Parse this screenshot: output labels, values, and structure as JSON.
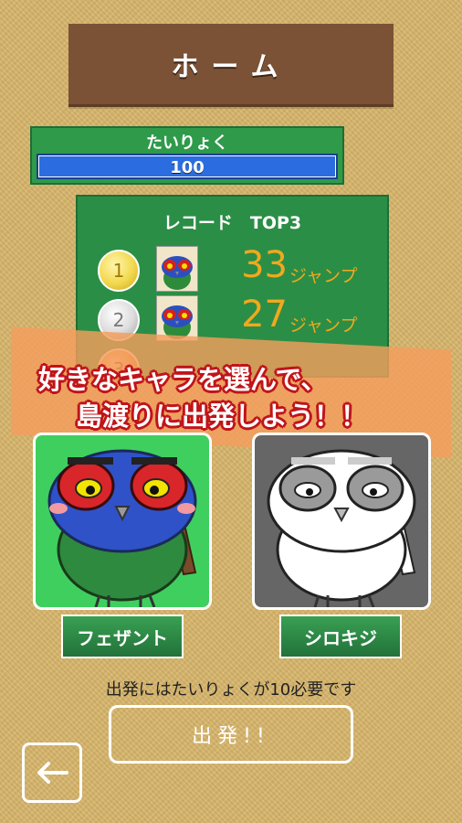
{
  "header": {
    "title": "ホーム"
  },
  "stamina": {
    "label": "たいりょく",
    "value": "100",
    "fraction": 1.0
  },
  "record": {
    "heading": "レコード　TOP3",
    "rows": [
      {
        "rank": "1",
        "score": "33",
        "unit": "ジャンプ",
        "medal": "gold"
      },
      {
        "rank": "2",
        "score": "27",
        "unit": "ジャンプ",
        "medal": "silver"
      },
      {
        "rank": "3",
        "score": "",
        "unit": "",
        "medal": "bronze"
      }
    ]
  },
  "message": {
    "line1": "好きなキャラを選んで、",
    "line2": "島渡りに出発しよう！！"
  },
  "characters": [
    {
      "name": "フェザント",
      "selected": true
    },
    {
      "name": "シロキジ",
      "selected": false
    }
  ],
  "requirement": "出発にはたいりょくが10必要です",
  "depart_label": "出発!!",
  "back_icon": "arrow-left-icon"
}
